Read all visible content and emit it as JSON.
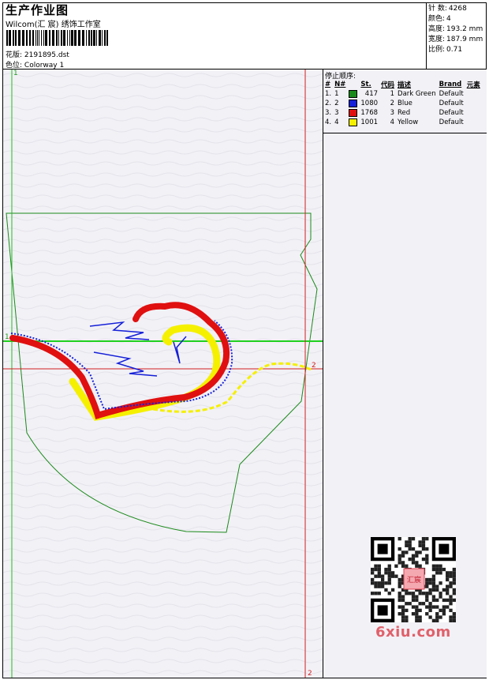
{
  "header": {
    "title": "生产作业图",
    "company": "Wilcom(汇 宸) 绣饰工作室",
    "design_label": "花版:",
    "design_value": "2191895.dst",
    "colorway_label": "色位:",
    "colorway_value": "Colorway 1"
  },
  "stats": [
    {
      "label": "针 数:",
      "value": "4268"
    },
    {
      "label": "颜色:",
      "value": "4"
    },
    {
      "label": "高度:",
      "value": "193.2 mm"
    },
    {
      "label": "宽度:",
      "value": "187.9 mm"
    },
    {
      "label": "比例:",
      "value": "0.71"
    }
  ],
  "stop_sequence": {
    "label": "停止顺序:",
    "headers": [
      "#",
      "N#",
      "St.",
      "代码",
      "描述",
      "Brand",
      "元素"
    ],
    "rows": [
      {
        "index": "1.",
        "n": "1",
        "color": "#1a8a1a",
        "stitches": "417",
        "code": "1",
        "desc": "Dark Green",
        "brand": "Default"
      },
      {
        "index": "2.",
        "n": "2",
        "color": "#1520d8",
        "stitches": "1080",
        "code": "2",
        "desc": "Blue",
        "brand": "Default"
      },
      {
        "index": "3.",
        "n": "3",
        "color": "#e01010",
        "stitches": "1768",
        "code": "3",
        "desc": "Red",
        "brand": "Default"
      },
      {
        "index": "4.",
        "n": "4",
        "color": "#f5f000",
        "stitches": "1001",
        "code": "4",
        "desc": "Yellow",
        "brand": "Default"
      }
    ]
  },
  "guides": {
    "v1_top": "1",
    "h1_left": "1",
    "h2_right": "2",
    "v2_bottom": "2"
  },
  "watermark": {
    "text": "6xiu.com",
    "seal": "汇宸"
  }
}
